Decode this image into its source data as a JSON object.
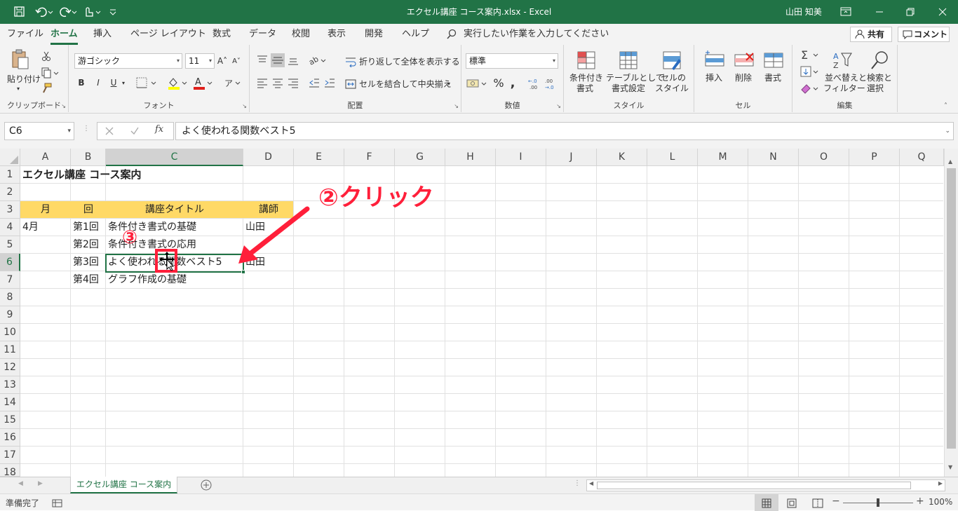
{
  "titlebar": {
    "title": "エクセル講座 コース案内.xlsx - Excel",
    "user": "山田 知美",
    "qat_save": "save-icon",
    "qat_undo": "undo-icon",
    "qat_redo": "redo-icon",
    "qat_touch": "touch-mode-icon",
    "qat_custom": "customize-icon"
  },
  "tabs": [
    "ファイル",
    "ホーム",
    "挿入",
    "ページ レイアウト",
    "数式",
    "データ",
    "校閲",
    "表示",
    "開発",
    "ヘルプ"
  ],
  "tell_me": "実行したい作業を入力してください",
  "share": "共有",
  "comment": "コメント",
  "ribbon": {
    "clipboard": {
      "paste": "貼り付け",
      "label": "クリップボード"
    },
    "font": {
      "name": "游ゴシック",
      "size": "11",
      "bold": "B",
      "italic": "I",
      "underline": "U",
      "label": "フォント"
    },
    "alignment": {
      "wrap": "折り返して全体を表示する",
      "merge": "セルを結合して中央揃え",
      "label": "配置"
    },
    "number": {
      "format": "標準",
      "percent": "%",
      "comma": ",",
      "label": "数値"
    },
    "styles": {
      "conditional": [
        "条件付き",
        "書式"
      ],
      "table": [
        "テーブルとして",
        "書式設定"
      ],
      "cellstyle": [
        "セルの",
        "スタイル"
      ],
      "label": "スタイル"
    },
    "cells": {
      "insert": "挿入",
      "delete": "削除",
      "format": "書式",
      "label": "セル"
    },
    "editing": {
      "sort": [
        "並べ替えと",
        "フィルター"
      ],
      "find": [
        "検索と",
        "選択"
      ],
      "label": "編集"
    }
  },
  "formula_bar": {
    "namebox": "C6",
    "fx": "fx",
    "content": "よく使われる関数ベスト5"
  },
  "columns": [
    "A",
    "B",
    "C",
    "D",
    "E",
    "F",
    "G",
    "H",
    "I",
    "J",
    "K",
    "L",
    "M",
    "N",
    "O",
    "P",
    "Q"
  ],
  "rows": [
    "1",
    "2",
    "3",
    "4",
    "5",
    "6",
    "7",
    "8",
    "9",
    "10",
    "11",
    "12",
    "13",
    "14",
    "15",
    "16",
    "17",
    "18"
  ],
  "cells": {
    "A1": "エクセル講座 コース案内",
    "A3": "月",
    "B3": "回",
    "C3": "講座タイトル",
    "D3": "講師",
    "A4": "4月",
    "B4": "第1回",
    "C4": "条件付き書式の基礎",
    "D4": "山田",
    "B5": "第2回",
    "C5": "条件付き書式の応用",
    "B6": "第3回",
    "C6": "よく使われる関数ベスト5",
    "D6": "山田",
    "B7": "第4回",
    "C7": "グラフ作成の基礎"
  },
  "header_fill": "#ffd966",
  "sheet_tab": "エクセル講座 コース案内",
  "status": {
    "ready": "準備完了",
    "zoom": "100%"
  },
  "annotations": {
    "click": "②クリック",
    "step3": "③",
    "color": "#ff1f3a"
  }
}
